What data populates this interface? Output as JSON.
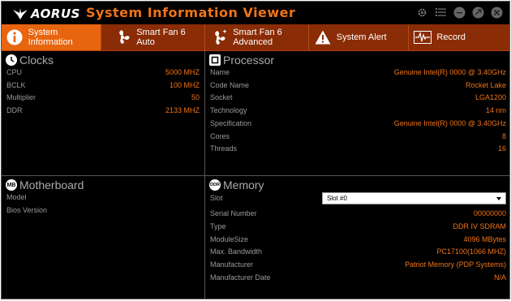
{
  "app": {
    "brand": "AORUS",
    "title": "System Information Viewer"
  },
  "window_controls": [
    {
      "icon": "gear-icon"
    },
    {
      "icon": "list-icon"
    },
    {
      "icon": "minimize-icon"
    },
    {
      "icon": "maximize-icon"
    },
    {
      "icon": "close-icon"
    }
  ],
  "tabs": [
    {
      "label": "System Information",
      "icon": "info-icon",
      "active": true
    },
    {
      "label": "Smart Fan 6 Auto",
      "icon": "fan-icon",
      "active": false
    },
    {
      "label": "Smart Fan 6 Advanced",
      "icon": "fan-advanced-icon",
      "active": false
    },
    {
      "label": "System Alert",
      "icon": "warning-icon",
      "active": false
    },
    {
      "label": "Record",
      "icon": "waveform-icon",
      "active": false
    }
  ],
  "clocks": {
    "title": "Clocks",
    "rows": [
      {
        "label": "CPU",
        "value": "5000 MHZ"
      },
      {
        "label": "BCLK",
        "value": "100 MHZ"
      },
      {
        "label": "Multiplier",
        "value": "50"
      },
      {
        "label": "DDR",
        "value": "2133 MHZ"
      }
    ]
  },
  "processor": {
    "title": "Processor",
    "rows": [
      {
        "label": "Name",
        "value": "Genuine Intel(R) 0000 @ 3.40GHz"
      },
      {
        "label": "Code Name",
        "value": "Rocket Lake"
      },
      {
        "label": "Socket",
        "value": "LGA1200"
      },
      {
        "label": "Technology",
        "value": "14 nm"
      },
      {
        "label": "Specification",
        "value": "Genuine Intel(R) 0000 @ 3.40GHz"
      },
      {
        "label": "Cores",
        "value": "8"
      },
      {
        "label": "Threads",
        "value": "16"
      }
    ]
  },
  "motherboard": {
    "title": "Motherboard",
    "icon_text": "MB",
    "rows": [
      {
        "label": "Model",
        "value": ""
      },
      {
        "label": "Bios Version",
        "value": ""
      }
    ]
  },
  "memory": {
    "title": "Memory",
    "icon_text": "DDR",
    "slot_label": "Slot",
    "slot_selected": "Slot #0",
    "rows": [
      {
        "label": "Serial Number",
        "value": "00000000"
      },
      {
        "label": "Type",
        "value": "DDR IV SDRAM"
      },
      {
        "label": "ModuleSize",
        "value": "4096 MBytes"
      },
      {
        "label": "Max. Bandwidth",
        "value": "PC17100(1066 MHZ)"
      },
      {
        "label": "Manufacturer",
        "value": "Patriot Memory (PDP Systems)"
      },
      {
        "label": "Manufacturer Date",
        "value": "N/A"
      }
    ]
  },
  "colors": {
    "accent": "#f07418",
    "tab_bar": "#8a2c06",
    "tab_active": "#e8650f",
    "background": "#000000"
  }
}
